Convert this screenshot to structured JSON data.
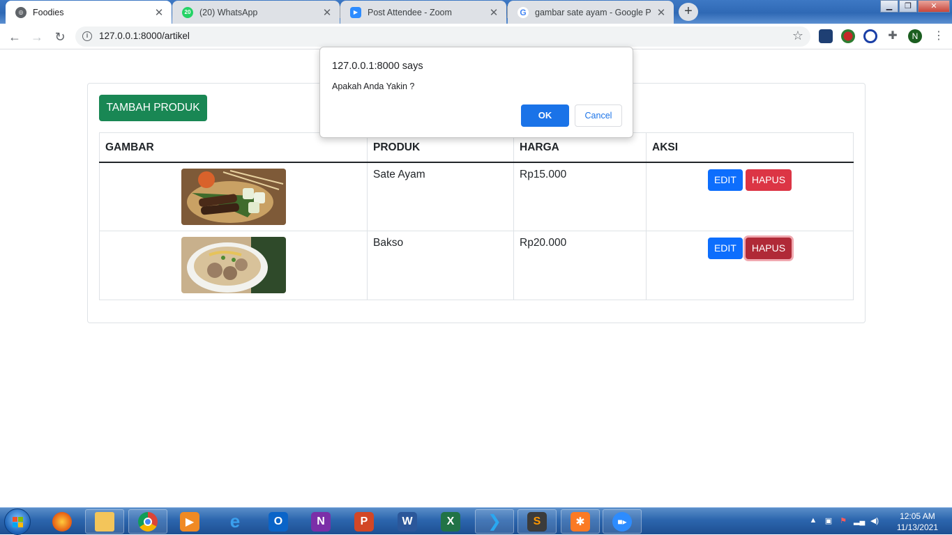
{
  "browser": {
    "tabs": [
      {
        "title": "Foodies",
        "active": true
      },
      {
        "title": "(20) WhatsApp",
        "active": false,
        "badge": "20"
      },
      {
        "title": "Post Attendee - Zoom",
        "active": false
      },
      {
        "title": "gambar sate ayam - Google Pene",
        "active": false,
        "favicon": "G"
      }
    ],
    "new_tab_label": "+",
    "close_label": "✕",
    "url": "127.0.0.1:8000/artikel",
    "profile_initial": "N"
  },
  "page": {
    "add_button": "TAMBAH PRODUK",
    "columns": [
      "GAMBAR",
      "PRODUK",
      "HARGA",
      "AKSI"
    ],
    "rows": [
      {
        "produk": "Sate Ayam",
        "harga": "Rp15.000",
        "image": "sate-ayam-photo"
      },
      {
        "produk": "Bakso",
        "harga": "Rp20.000",
        "image": "bakso-photo"
      }
    ],
    "edit_label": "EDIT",
    "delete_label": "HAPUS"
  },
  "dialog": {
    "origin": "127.0.0.1:8000 says",
    "message": "Apakah Anda Yakin ?",
    "ok_label": "OK",
    "cancel_label": "Cancel"
  },
  "taskbar": {
    "time": "12:05 AM",
    "date": "11/13/2021",
    "apps": [
      "firefox",
      "file-explorer",
      "chrome",
      "media-player",
      "internet-explorer",
      "outlook",
      "onenote",
      "powerpoint",
      "word",
      "excel",
      "vscode",
      "sublime-text",
      "xampp",
      "zoom"
    ]
  }
}
